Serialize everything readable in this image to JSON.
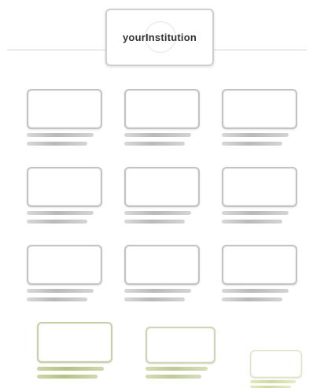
{
  "header": {
    "institution_name": "yourInstitution"
  },
  "colors": {
    "card_border": "#c3c3c3",
    "bar_gray": "#b9b9b9",
    "accent_green": "#b4c184"
  }
}
